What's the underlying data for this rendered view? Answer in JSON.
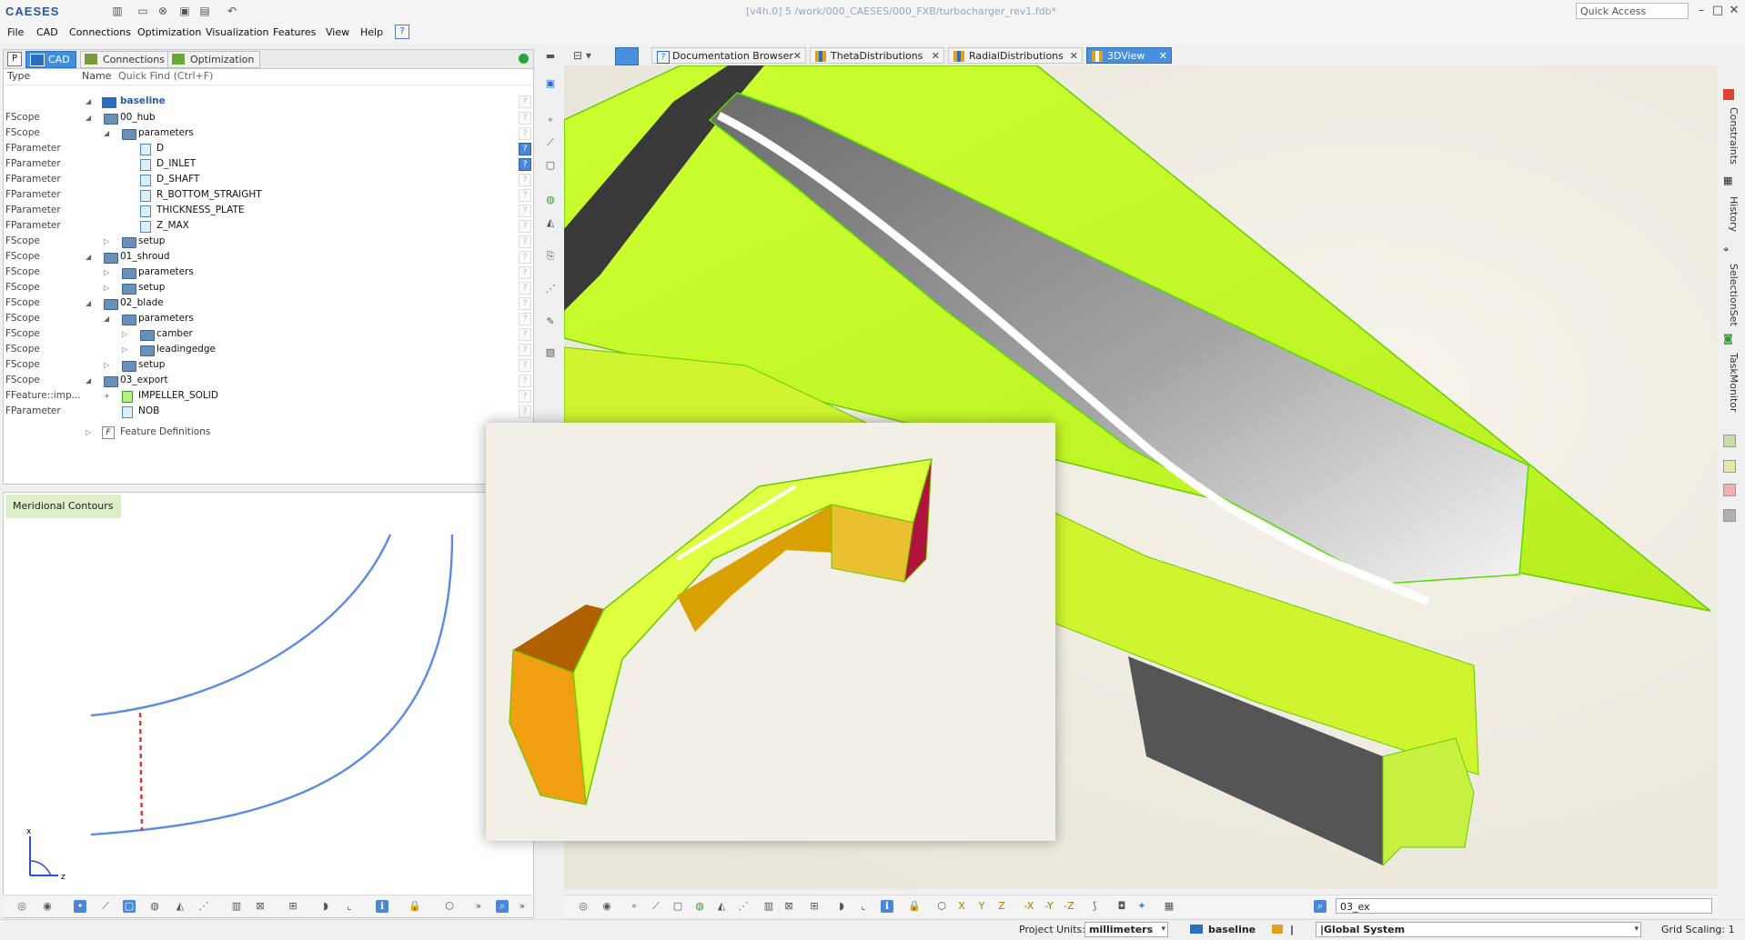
{
  "app": {
    "logo": "CAESES",
    "doc_title": "[v4h.0] 5 /work/000_CAESES/000_FXB/turbocharger_rev1.fdb*",
    "quick_access": "Quick Access (Ctrl+Q)"
  },
  "menu": [
    "File",
    "CAD",
    "Connections",
    "Optimization",
    "Visualization",
    "Features",
    "View",
    "Help"
  ],
  "left_tabs": [
    {
      "label": "CAD",
      "active": true
    },
    {
      "label": "Connections",
      "active": false
    },
    {
      "label": "Optimization",
      "active": false
    }
  ],
  "left_p": "P",
  "columns": {
    "type": "Type",
    "name": "Name",
    "quick_find": "Quick Find (Ctrl+F)"
  },
  "tree": {
    "root": "baseline",
    "rows": [
      {
        "type": "FScope",
        "label": "00_hub",
        "indent": 1,
        "kind": "folder",
        "expand": "open"
      },
      {
        "type": "FScope",
        "label": "parameters",
        "indent": 2,
        "kind": "folder",
        "expand": "open"
      },
      {
        "type": "FParameter",
        "label": "D",
        "indent": 3,
        "kind": "param",
        "help": true
      },
      {
        "type": "FParameter",
        "label": "D_INLET",
        "indent": 3,
        "kind": "param",
        "help": true
      },
      {
        "type": "FParameter",
        "label": "D_SHAFT",
        "indent": 3,
        "kind": "param"
      },
      {
        "type": "FParameter",
        "label": "R_BOTTOM_STRAIGHT",
        "indent": 3,
        "kind": "param"
      },
      {
        "type": "FParameter",
        "label": "THICKNESS_PLATE",
        "indent": 3,
        "kind": "param"
      },
      {
        "type": "FParameter",
        "label": "Z_MAX",
        "indent": 3,
        "kind": "param"
      },
      {
        "type": "FScope",
        "label": "setup",
        "indent": 2,
        "kind": "folder",
        "expand": "closed"
      },
      {
        "type": "FScope",
        "label": "01_shroud",
        "indent": 1,
        "kind": "folder",
        "expand": "open"
      },
      {
        "type": "FScope",
        "label": "parameters",
        "indent": 2,
        "kind": "folder",
        "expand": "closed"
      },
      {
        "type": "FScope",
        "label": "setup",
        "indent": 2,
        "kind": "folder",
        "expand": "closed"
      },
      {
        "type": "FScope",
        "label": "02_blade",
        "indent": 1,
        "kind": "folder",
        "expand": "open"
      },
      {
        "type": "FScope",
        "label": "parameters",
        "indent": 2,
        "kind": "folder",
        "expand": "open"
      },
      {
        "type": "FScope",
        "label": "camber",
        "indent": 3,
        "kind": "folder",
        "expand": "closed"
      },
      {
        "type": "FScope",
        "label": "leadingedge",
        "indent": 3,
        "kind": "folder",
        "expand": "closed"
      },
      {
        "type": "FScope",
        "label": "setup",
        "indent": 2,
        "kind": "folder",
        "expand": "closed"
      },
      {
        "type": "FScope",
        "label": "03_export",
        "indent": 1,
        "kind": "folder",
        "expand": "open"
      },
      {
        "type": "FFeature::imp...",
        "label": "IMPELLER_SOLID",
        "indent": 2,
        "kind": "feature",
        "expand": "plus"
      },
      {
        "type": "FParameter",
        "label": "NOB",
        "indent": 2,
        "kind": "param"
      }
    ],
    "feature_defs": "Feature Definitions"
  },
  "meridional": {
    "tab": "Meridional Contours",
    "axis_x": "x",
    "axis_z": "z"
  },
  "right_tabs": [
    {
      "label": "Documentation Browser",
      "active": false
    },
    {
      "label": "ThetaDistributions",
      "active": false
    },
    {
      "label": "RadialDistributions",
      "active": false
    },
    {
      "label": "3DView",
      "active": true
    }
  ],
  "selection_field": "03_ex",
  "side_tabs": [
    "Constraints",
    "History",
    "SelectionSet",
    "TaskMonitor"
  ],
  "status": {
    "units_label": "Project Units:",
    "units_value": "millimeters",
    "design": "baseline",
    "system": "|Global System",
    "grid_label": "Grid Scaling: 1"
  },
  "colors": {
    "accent": "#4a8fdc",
    "surface_green": "#d4ff3c",
    "blade_gray": "#9a9a9a",
    "orange": "#e89a10",
    "crimson": "#b0143a",
    "curve_blue": "#5b8ce0",
    "dash_red": "#e03030"
  }
}
